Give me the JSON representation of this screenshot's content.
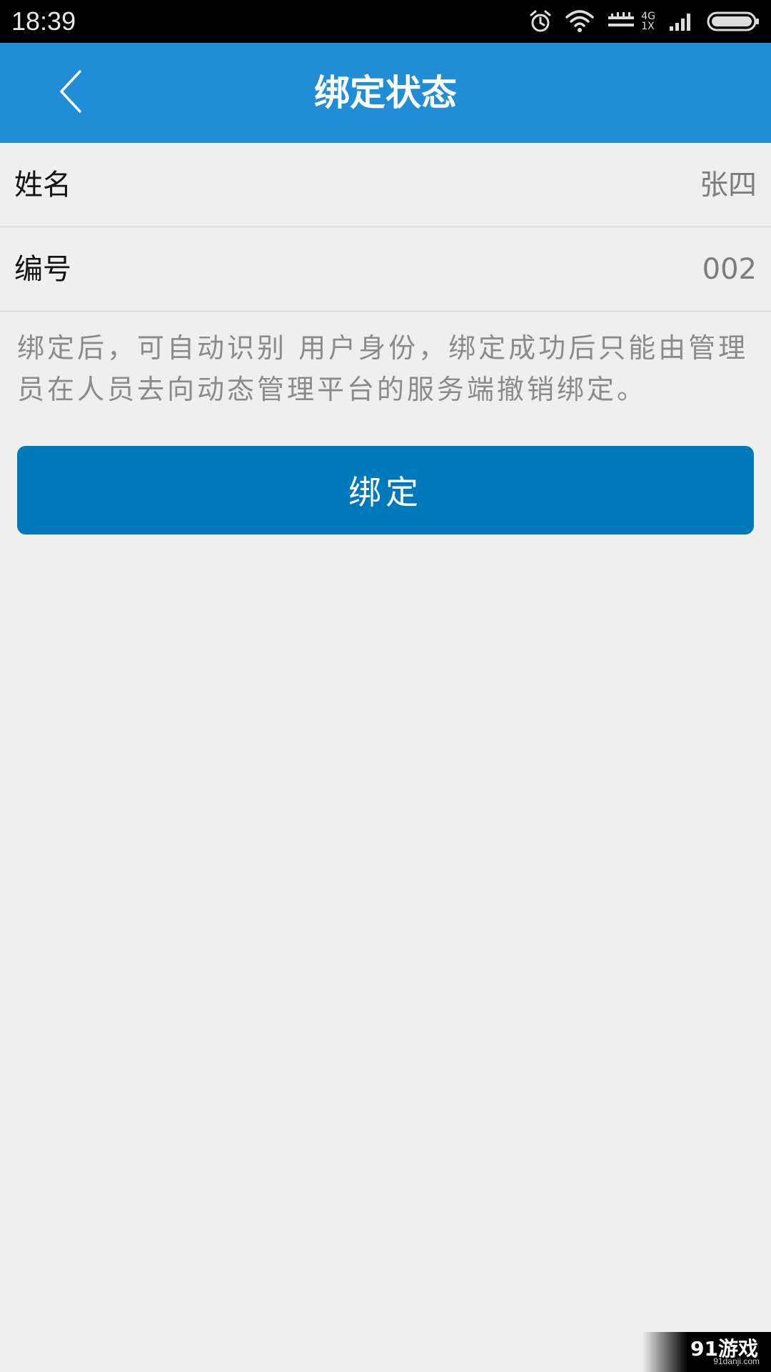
{
  "status_bar": {
    "time": "18:39",
    "network_type": "4G",
    "sim_label": "1X",
    "icons": [
      "alarm-icon",
      "wifi-icon",
      "data-signal-icon",
      "cell-signal-icon",
      "battery-icon"
    ]
  },
  "header": {
    "title": "绑定状态",
    "back_icon": "chevron-left-icon",
    "background": "#218dd6"
  },
  "rows": [
    {
      "label": "姓名",
      "value": "张四"
    },
    {
      "label": "编号",
      "value": "002"
    }
  ],
  "notice": "绑定后，可自动识别 用户身份，绑定成功后只能由管理员在人员去向动态管理平台的服务端撤销绑定。",
  "bind_button": {
    "label": "绑定",
    "background": "#0079bb"
  },
  "watermark": {
    "logo": "91游戏",
    "url": "91danji.com"
  }
}
